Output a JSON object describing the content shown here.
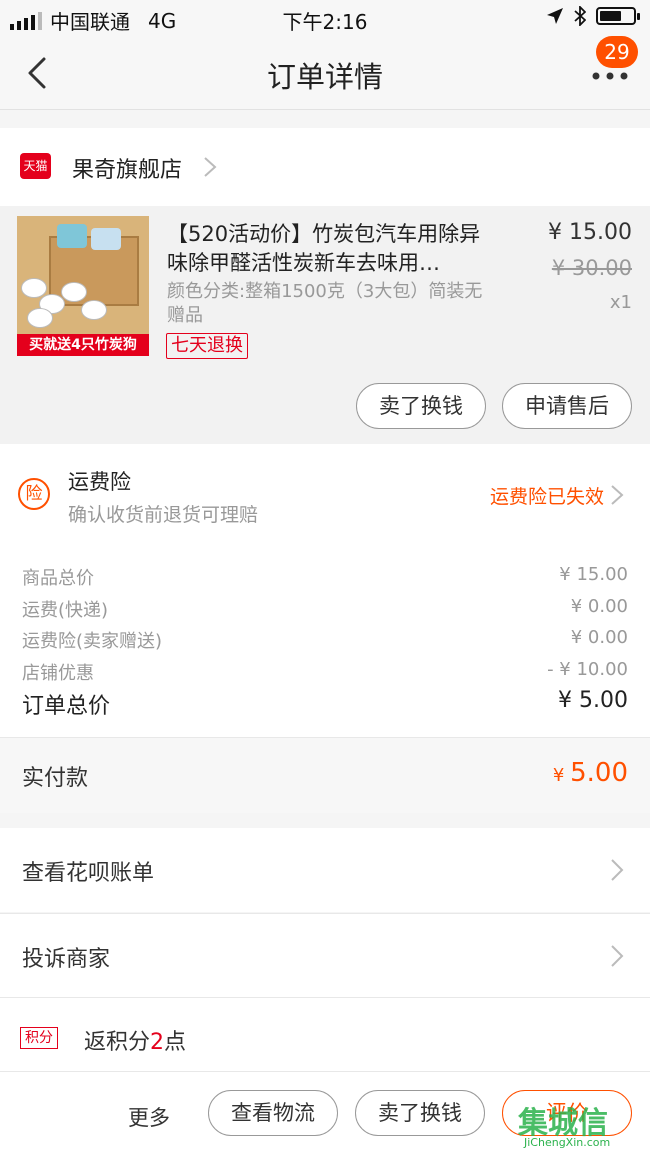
{
  "status_bar": {
    "carrier": "中国联通",
    "network": "4G",
    "time": "下午2:16",
    "battery_level": 0.65
  },
  "nav": {
    "title": "订单详情",
    "badge": "29",
    "back_icon": "chevron-left-icon",
    "more_icon": "more-dots-icon"
  },
  "store": {
    "logo_text": "天猫",
    "name": "果奇旗舰店"
  },
  "item": {
    "title": "【520活动价】竹炭包汽车用除异味除甲醛活性炭新车去味用…",
    "spec": "颜色分类:整箱1500克（3大包）简装无赠品",
    "tag": "七天退换",
    "price": "¥ 15.00",
    "original_price": "¥ 30.00",
    "quantity": "x1",
    "image_banner": "买就送4只竹炭狗",
    "actions": {
      "resell": "卖了换钱",
      "after_sale": "申请售后"
    }
  },
  "insurance": {
    "icon_text": "险",
    "title": "运费险",
    "subtitle": "确认收货前退货可理赔",
    "status": "运费险已失效"
  },
  "totals": {
    "rows": [
      {
        "label": "商品总价",
        "value": "¥ 15.00"
      },
      {
        "label": "运费(快递)",
        "value": "¥ 0.00"
      },
      {
        "label": "运费险(卖家赠送)",
        "value": "¥ 0.00"
      },
      {
        "label": "店铺优惠",
        "value": "- ¥ 10.00"
      }
    ],
    "order_total_label": "订单总价",
    "order_total_value": "¥ 5.00"
  },
  "paid": {
    "label": "实付款",
    "currency": "¥",
    "amount": "5.00"
  },
  "links": {
    "huabei": "查看花呗账单",
    "complaint": "投诉商家"
  },
  "points": {
    "tag": "积分",
    "text_prefix": "返积分",
    "count": "2",
    "text_suffix": "点"
  },
  "footer": {
    "more": "更多",
    "logistics": "查看物流",
    "resell": "卖了换钱",
    "review": "评价"
  },
  "watermark": {
    "logo": "集城信",
    "url": "JiChengXin.com"
  },
  "colors": {
    "accent": "#ff5000",
    "tmall_red": "#e4001c"
  }
}
